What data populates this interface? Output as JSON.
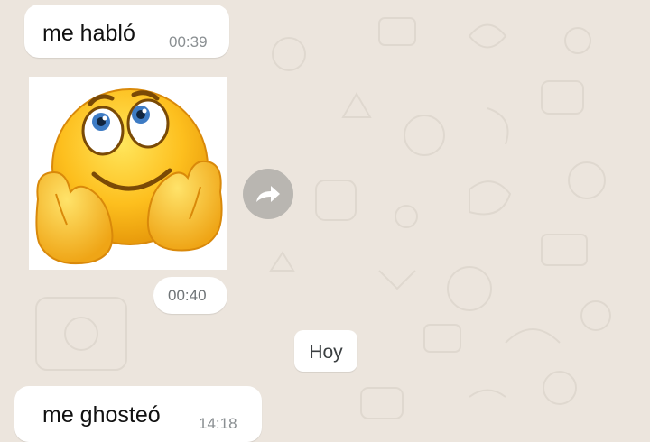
{
  "chat": {
    "messages": [
      {
        "text": "me habló",
        "time": "00:39"
      },
      {
        "sticker": "smiley-dreaming-sticker",
        "time": "00:40"
      },
      {
        "text": "me ghosteó",
        "time": "14:18"
      }
    ],
    "date_separator": "Hoy"
  },
  "icons": {
    "forward": "forward-icon"
  },
  "colors": {
    "background": "#ECE5DD",
    "bubble": "#FFFFFF",
    "forward_button": "#B9B6B1",
    "timestamp": "#8a8f92"
  }
}
